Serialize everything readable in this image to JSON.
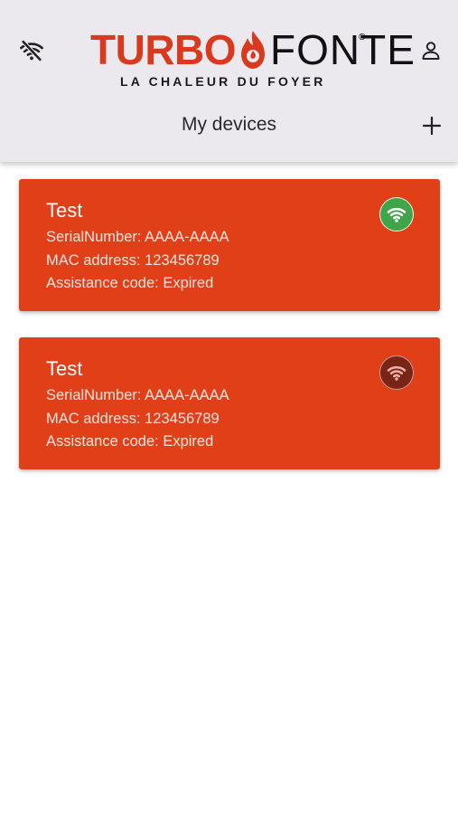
{
  "header": {
    "brand_turbo": "TURBO",
    "brand_fonte": "FONTE",
    "brand_reg": "®",
    "tagline": "LA CHALEUR DU FOYER",
    "title": "My devices",
    "wifi_off_icon": "wifi-off-icon",
    "profile_icon": "user-icon",
    "add_icon": "plus-icon"
  },
  "colors": {
    "header_bg": "#ebe8ee",
    "brand_red": "#d93a1e",
    "card_bg": "#e03f18",
    "online": "#3fa548",
    "offline": "#7a2415"
  },
  "devices": [
    {
      "name": "Test",
      "serial": "SerialNumber: AAAA-AAAA",
      "mac": "MAC address: 123456789",
      "assistance": "Assistance code: Expired",
      "status": "online",
      "status_icon": "wifi-icon"
    },
    {
      "name": "Test",
      "serial": "SerialNumber: AAAA-AAAA",
      "mac": "MAC address: 123456789",
      "assistance": "Assistance code: Expired",
      "status": "offline",
      "status_icon": "wifi-icon"
    }
  ]
}
